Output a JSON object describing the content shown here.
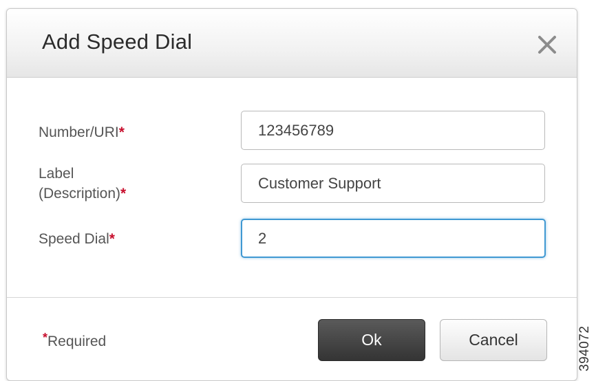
{
  "dialog": {
    "title": "Add Speed Dial",
    "close_icon": "close-icon"
  },
  "form": {
    "number_uri": {
      "label": "Number/URI",
      "value": "123456789"
    },
    "label_description": {
      "label_line1": "Label",
      "label_line2": "(Description)",
      "value": "Customer Support"
    },
    "speed_dial": {
      "label": "Speed Dial",
      "value": "2",
      "focused": true
    },
    "required_marker": "*"
  },
  "footer": {
    "required_note": "Required",
    "ok_label": "Ok",
    "cancel_label": "Cancel"
  },
  "figure_id": "394072",
  "colors": {
    "required_star": "#c8102e",
    "focus_border": "#3f98d2",
    "ok_button": "#3c3c3c"
  }
}
